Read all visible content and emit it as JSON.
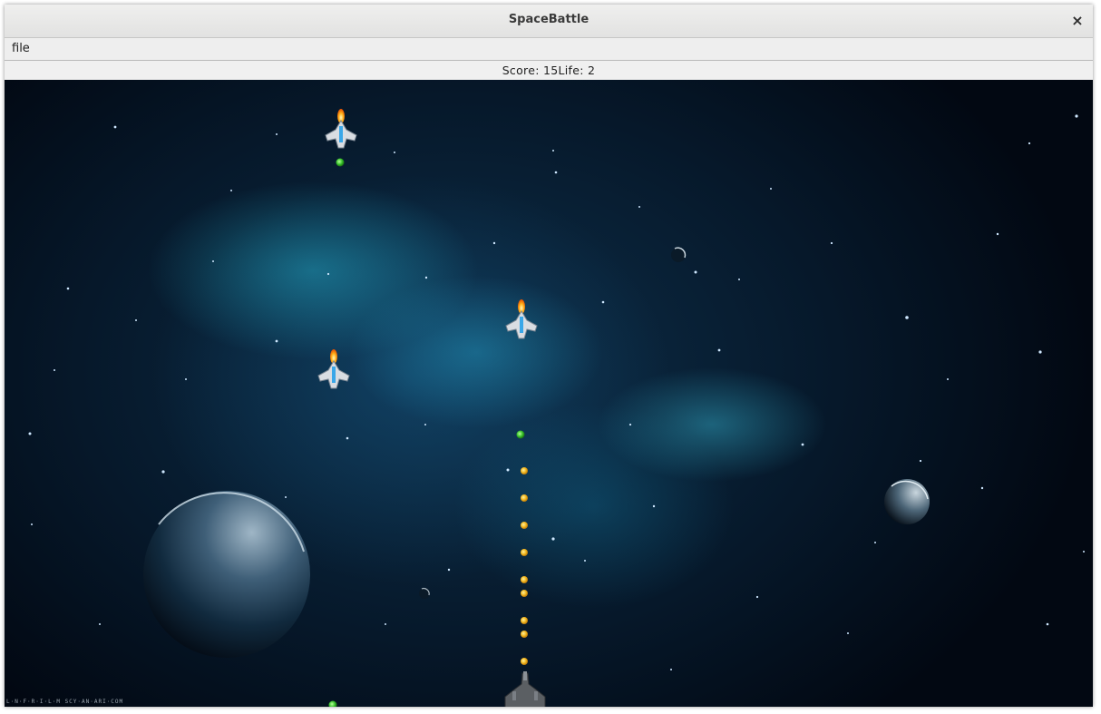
{
  "window": {
    "title": "SpaceBattle",
    "close_glyph": "×",
    "close_icon": "close-icon"
  },
  "menu": {
    "items": [
      {
        "label": "file"
      }
    ]
  },
  "status": {
    "score_label": "Score:",
    "score_value": "15",
    "life_label": "Life:",
    "life_value": "2"
  },
  "game": {
    "background": "space-nebula",
    "credit_text": "L·N·F·R·I·L·M  SCY·AN·ARI·COM",
    "colors": {
      "enemy_bullet": "#37c12a",
      "player_bullet": "#f2b51c",
      "nebula": "#2fb6d4"
    }
  }
}
